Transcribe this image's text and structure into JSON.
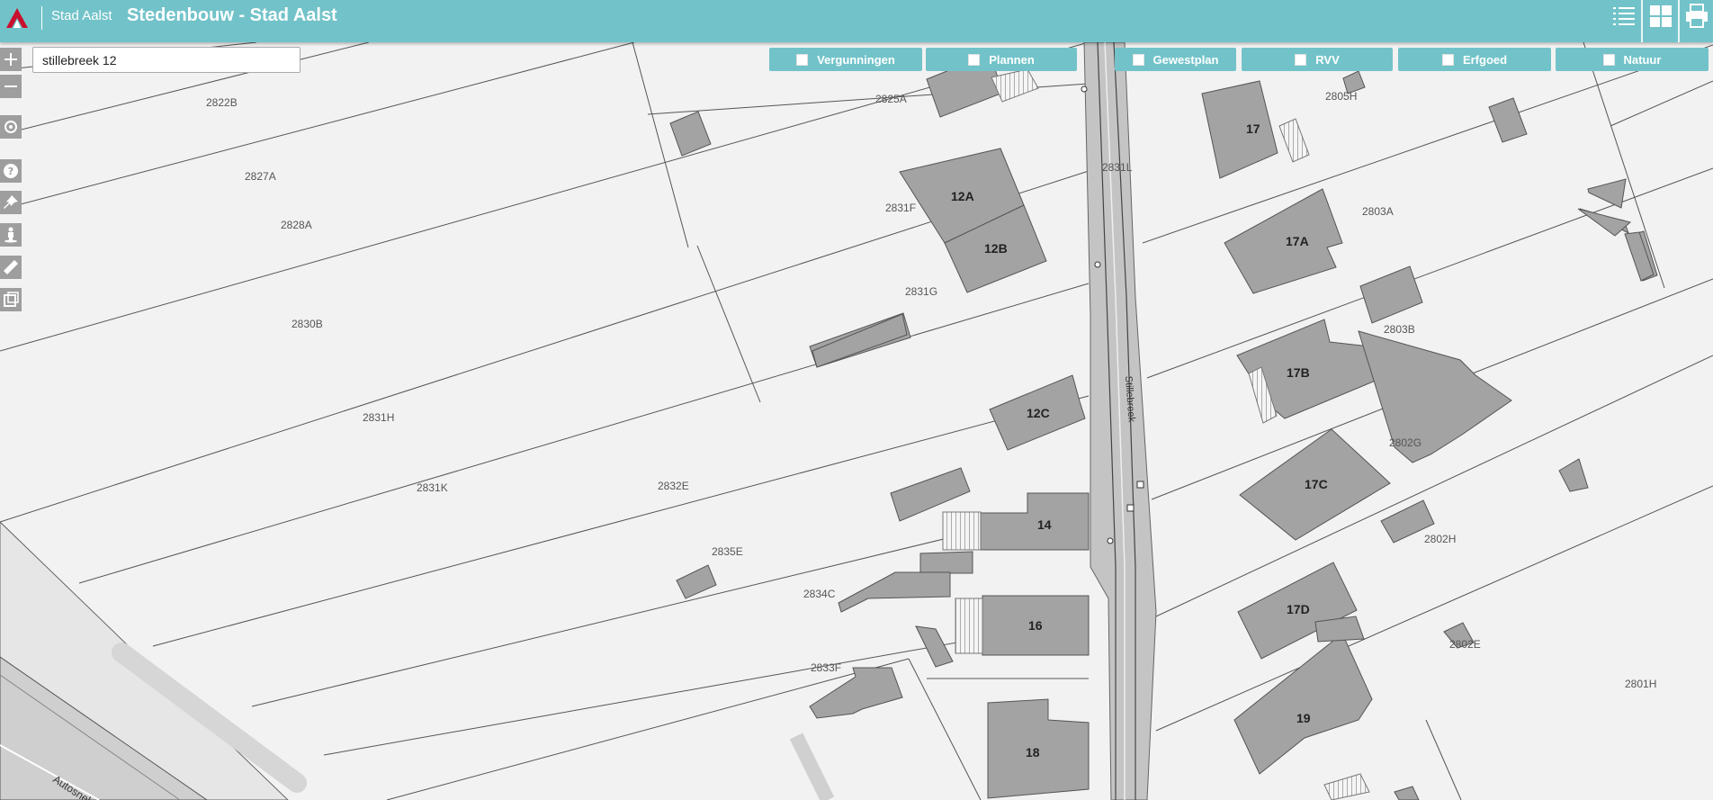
{
  "header": {
    "brand": "Stad Aalst",
    "title": "Stedenbouw - Stad Aalst"
  },
  "search": {
    "value": "stillebreek 12"
  },
  "layers": [
    {
      "label": "Vergunningen",
      "checked": false
    },
    {
      "label": "Plannen",
      "checked": false
    },
    {
      "label": "Gewestplan",
      "checked": false
    },
    {
      "label": "RVV",
      "checked": false
    },
    {
      "label": "Erfgoed",
      "checked": false
    },
    {
      "label": "Natuur",
      "checked": false
    }
  ],
  "tools": [
    "zoom-in-icon",
    "zoom-out-icon",
    "locate-icon",
    "help-icon",
    "pin-icon",
    "street-view-icon",
    "measure-icon",
    "select-area-icon"
  ],
  "map": {
    "street_name": "Stillebreek",
    "highway_label": "Autosnelweg",
    "parcels": [
      "2822B",
      "2827A",
      "2828A",
      "2830B",
      "2831H",
      "2831K",
      "2832E",
      "2835E",
      "2834C",
      "2833F",
      "2825A",
      "2831F",
      "2831G",
      "2831L",
      "2805H",
      "2803A",
      "2803B",
      "2802G",
      "2802H",
      "2802E",
      "2801H"
    ],
    "house_numbers": [
      "12A",
      "12B",
      "12C",
      "14",
      "16",
      "18",
      "17",
      "17A",
      "17B",
      "17C",
      "17D",
      "19"
    ]
  },
  "colors": {
    "accent": "#72c3c9",
    "building": "#a3a3a3",
    "map_bg": "#f2f2f2"
  }
}
